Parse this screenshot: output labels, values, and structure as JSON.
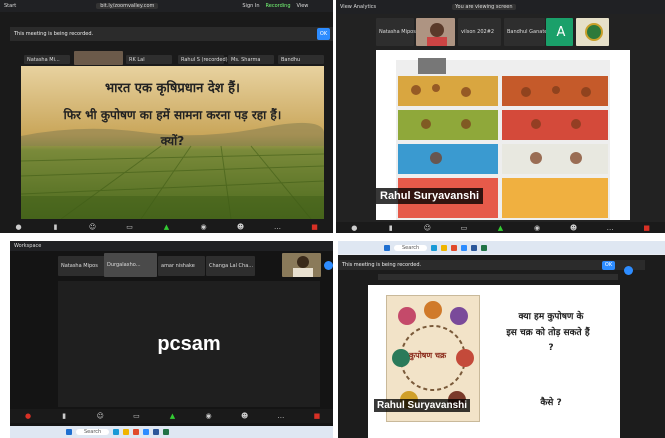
{
  "q1": {
    "topbar_left": "Start",
    "url_text": "bit.ly/zoomvalley.com",
    "topbar_right": [
      "Sign In",
      "Recording",
      "View"
    ],
    "banner": "This meeting is being recorded.",
    "ok_label": "OK",
    "thumbs": [
      "Natasha Mi...",
      "",
      "RK Lal",
      "Rahul S (recorded)",
      "Ms. Sharma",
      "Bandhu"
    ],
    "slide_line1": "भारत एक कृषिप्रधान देश हैं।",
    "slide_line2": "फिर भी कुपोषण का हमें सामना करना पड़ रहा हैं।",
    "slide_line3": "क्यों?"
  },
  "q2": {
    "topbar_left": "View Analytics",
    "thumbs": [
      "Natasha Mipos",
      "",
      "vilson 202#2",
      "Bandhul Ganate",
      "A"
    ],
    "nameplate": "Rahul Suryavanshi",
    "share_label": "You are viewing screen"
  },
  "q3": {
    "topbar_left": "Workspace",
    "thumbs": [
      "Natasha Mipos",
      "Durgalaxho...",
      "amar nishake",
      "Changa Lal Cha...",
      ""
    ],
    "center_text": "pcsam",
    "search_placeholder": "Search"
  },
  "q4": {
    "banner": "This meeting is being recorded.",
    "ok_label": "OK",
    "search_placeholder": "Search",
    "slide_q1": "क्या हम कुपोषण के",
    "slide_q2": "इस चक्र को तोड़ सकते हैं",
    "slide_q3": "?",
    "slide_q4": "कैसे ?",
    "poster_title": "कुपोषण चक्र",
    "nameplate": "Rahul Suryavanshi"
  },
  "colors": {
    "zoom_blue": "#2d8cff",
    "end_red": "#d93025",
    "panel_dark": "#1a1a1a",
    "taskbar": "#dfe7f2"
  },
  "icons": [
    "mic-icon",
    "video-icon",
    "participants-icon",
    "share-icon",
    "chat-icon",
    "record-icon",
    "reactions-icon",
    "more-icon",
    "windows-start-icon",
    "search-icon"
  ]
}
